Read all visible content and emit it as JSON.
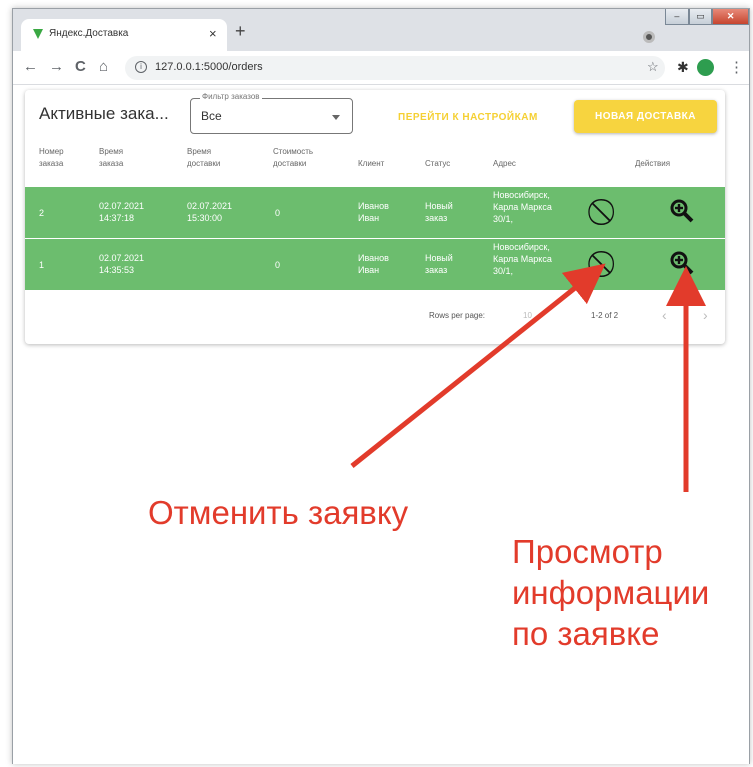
{
  "browser": {
    "tab_title": "Яндекс.Доставка",
    "tab_close": "×",
    "new_tab": "+",
    "url": "127.0.0.1:5000/orders",
    "back": "←",
    "forward": "→",
    "reload": "C",
    "home": "⌂",
    "menu": "⋮",
    "win_minimize": "–",
    "win_maximize": "▭",
    "win_close": "✕",
    "favicon_color": "#3aa843"
  },
  "header": {
    "title": "Активные зака...",
    "filter_label": "Фильтр заказов",
    "filter_value": "Все",
    "settings_button": "ПЕРЕЙТИ К НАСТРОЙКАМ",
    "new_delivery_button": "НОВАЯ ДОСТАВКА",
    "accent_color": "#f7d43f"
  },
  "table": {
    "columns": [
      "Номер заказа",
      "Время заказа",
      "Время доставки",
      "Стоимость доставки",
      "Клиент",
      "Статус",
      "Адрес",
      "Действия"
    ],
    "row_color": "#6cbd6e",
    "rows": [
      {
        "number": "2",
        "order_time": "02.07.2021 14:37:18",
        "delivery_time": "02.07.2021 15:30:00",
        "cost": "0",
        "client": "Иванов Иван",
        "status": "Новый заказ",
        "address": "Новосибирск, Карла Маркса 30/1,"
      },
      {
        "number": "1",
        "order_time": "02.07.2021 14:35:53",
        "delivery_time": "",
        "cost": "0",
        "client": "Иванов Иван",
        "status": "Новый заказ",
        "address": "Новосибирск, Карла Маркса 30/1,"
      }
    ],
    "cancel_icon": "cancel-icon",
    "view_icon": "zoom-in-icon"
  },
  "pagination": {
    "rows_per_page_label": "Rows per page:",
    "rows_per_page_value": "10",
    "range": "1-2 of 2",
    "prev": "‹",
    "next": "›"
  },
  "annotations": {
    "cancel_text": "Отменить заявку",
    "view_text_1": "Просмотр",
    "view_text_2": "информации",
    "view_text_3": "по заявке",
    "color": "#e23b2b"
  }
}
